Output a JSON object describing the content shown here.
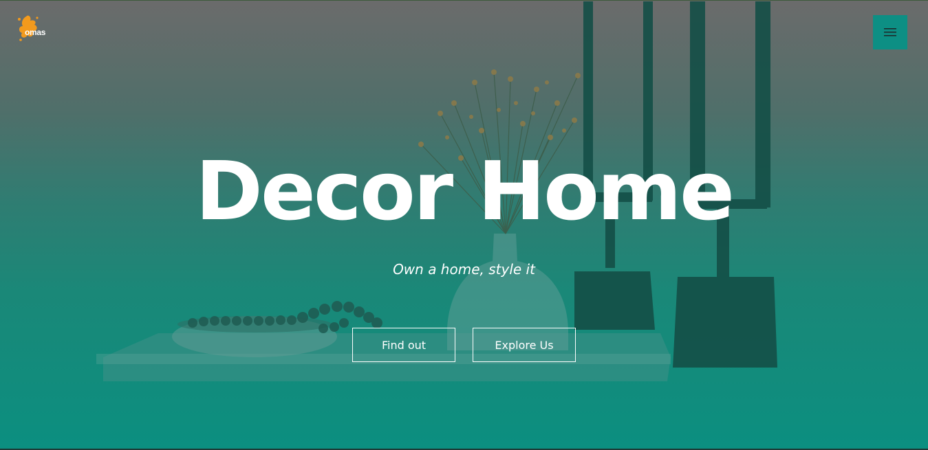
{
  "brand": {
    "logo_text": "omas",
    "logo_color": "#f39a1d",
    "logo_icon": "splash-logo-icon"
  },
  "header": {
    "menu_icon": "hamburger-menu-icon",
    "menu_color": "#0d8f84"
  },
  "hero": {
    "title": "Decor Home",
    "subtitle": "Own a home, style it",
    "buttons": {
      "find_out": "Find out",
      "explore_us": "Explore Us"
    },
    "overlay_color": "#0b8f80"
  }
}
